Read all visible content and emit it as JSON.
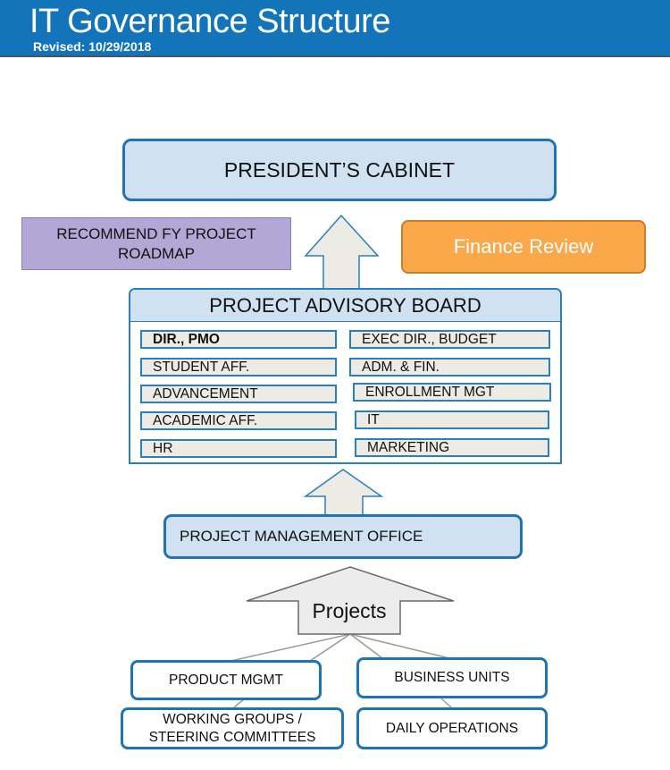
{
  "header": {
    "title": "IT Governance Structure",
    "subtitle": "Revised: 10/29/2018"
  },
  "colors": {
    "header_bg": "#1374ba",
    "primary_border": "#1f74b6",
    "light_blue_fill": "#d0e2f2",
    "roadmap_fill": "#b3a7d5",
    "finance_fill": "#fba84b",
    "member_fill": "#ecebe4",
    "arrow_fill": "#ecebe4",
    "projects_arrow_fill": "#ececec"
  },
  "top": {
    "cabinet": "PRESIDENT’S CABINET",
    "roadmap_line1": "RECOMMEND FY PROJECT",
    "roadmap_line2": "ROADMAP",
    "finance": "Finance Review"
  },
  "advisory_board": {
    "title": "PROJECT ADVISORY BOARD",
    "left": [
      {
        "label": "DIR., PMO",
        "bold": true
      },
      {
        "label": "STUDENT AFF.",
        "bold": false
      },
      {
        "label": "ADVANCEMENT",
        "bold": false
      },
      {
        "label": "ACADEMIC AFF.",
        "bold": false
      },
      {
        "label": "HR",
        "bold": false
      }
    ],
    "right": [
      {
        "label": "EXEC DIR., BUDGET",
        "bold": false
      },
      {
        "label": "ADM. & FIN.",
        "bold": false
      },
      {
        "label": "ENROLLMENT MGT",
        "bold": false
      },
      {
        "label": "IT",
        "bold": false
      },
      {
        "label": "MARKETING",
        "bold": false
      }
    ]
  },
  "pmo": "PROJECT MANAGEMENT OFFICE",
  "projects": "Projects",
  "sources": {
    "product_mgmt": "PRODUCT MGMT",
    "business_units": "BUSINESS UNITS",
    "working_groups_line1": "WORKING GROUPS /",
    "working_groups_line2": "STEERING COMMITTEES",
    "daily_operations": "DAILY OPERATIONS"
  }
}
